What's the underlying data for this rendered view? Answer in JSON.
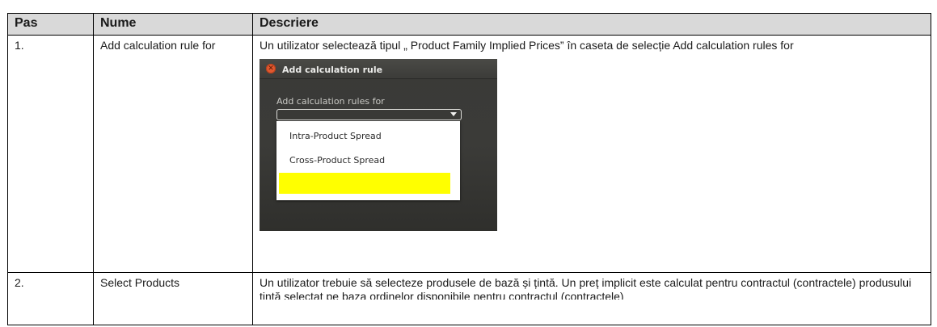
{
  "table": {
    "headers": [
      "Pas",
      "Nume",
      "Descriere"
    ],
    "rows": [
      {
        "step": "1.",
        "name": "Add calculation rule for",
        "description": "Un utilizator selectează tipul „ Product Family Implied Prices” în caseta de selecție Add calculation rules for"
      },
      {
        "step": "2.",
        "name": "Select Products",
        "description": "Un utilizator trebuie să selecteze produsele de bază și țintă. Un preț implicit este calculat pentru contractul (contractele) produsului țintă selectat pe baza ordinelor disponibile pentru contractul (contractele)"
      }
    ]
  },
  "dialog": {
    "title": "Add calculation rule",
    "field_label": "Add calculation rules for",
    "selected_value": "",
    "options": [
      "Intra-Product Spread",
      "Cross-Product Spread",
      ""
    ],
    "highlight_color": "#ffff00",
    "close_icon": "close-icon"
  }
}
